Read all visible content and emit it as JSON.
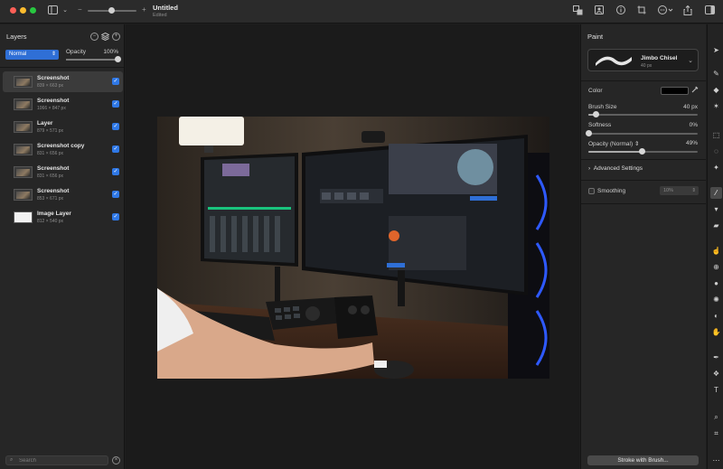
{
  "window": {
    "title": "Untitled",
    "subtitle": "Edited",
    "zoom_minus": "−",
    "zoom_plus": "+"
  },
  "layers_panel": {
    "title": "Layers",
    "blend_mode": "Normal",
    "opacity_label": "Opacity",
    "opacity_value": "100%",
    "opacity_fraction": 1.0,
    "layers": [
      {
        "name": "Screenshot",
        "size": "839 × 663 px",
        "visible": true,
        "selected": true,
        "thumb": "photo"
      },
      {
        "name": "Screenshot",
        "size": "1066 × 847 px",
        "visible": true,
        "selected": false,
        "thumb": "photo"
      },
      {
        "name": "Layer",
        "size": "879 × 571 px",
        "visible": true,
        "selected": false,
        "thumb": "photo"
      },
      {
        "name": "Screenshot copy",
        "size": "831 × 656 px",
        "visible": true,
        "selected": false,
        "thumb": "photo"
      },
      {
        "name": "Screenshot",
        "size": "831 × 656 px",
        "visible": true,
        "selected": false,
        "thumb": "photo"
      },
      {
        "name": "Screenshot",
        "size": "853 × 671 px",
        "visible": true,
        "selected": false,
        "thumb": "photo"
      },
      {
        "name": "Image Layer",
        "size": "812 × 540 px",
        "visible": true,
        "selected": false,
        "thumb": "white"
      }
    ],
    "search_placeholder": "Search"
  },
  "paint_panel": {
    "title": "Paint",
    "brush_name": "Jimbo Chisel",
    "brush_size_text": "40 px",
    "color_label": "Color",
    "color_value": "#000000",
    "brush_size_label": "Brush Size",
    "brush_size_value": "40 px",
    "brush_size_fraction": 0.07,
    "softness_label": "Softness",
    "softness_value": "0%",
    "softness_fraction": 0.0,
    "opacity_label": "Opacity (Normal)",
    "opacity_value": "49%",
    "opacity_fraction": 0.49,
    "advanced_label": "Advanced Settings",
    "smoothing_label": "Smoothing",
    "smoothing_value": "10%",
    "stroke_button": "Stroke with Brush..."
  },
  "tools": [
    "pointer-tool-icon",
    "pen-tool-icon",
    "shape-tool-icon",
    "star-tool-icon",
    "rect-select-icon",
    "lasso-select-icon",
    "magic-select-icon",
    "brush-tool-icon",
    "paint-bucket-icon",
    "eraser-icon",
    "smudge-icon",
    "clone-icon",
    "blur-icon",
    "sharpen-icon",
    "dodge-icon",
    "hand-retouch-icon",
    "vector-pen-icon",
    "shapes-icon",
    "text-tool-icon",
    "zoom-tool-icon",
    "crop-tool-icon",
    "more-tools-icon"
  ],
  "colors": {
    "accent": "#2f78e6",
    "panel": "#262626",
    "canvas": "#1b1b1b"
  }
}
